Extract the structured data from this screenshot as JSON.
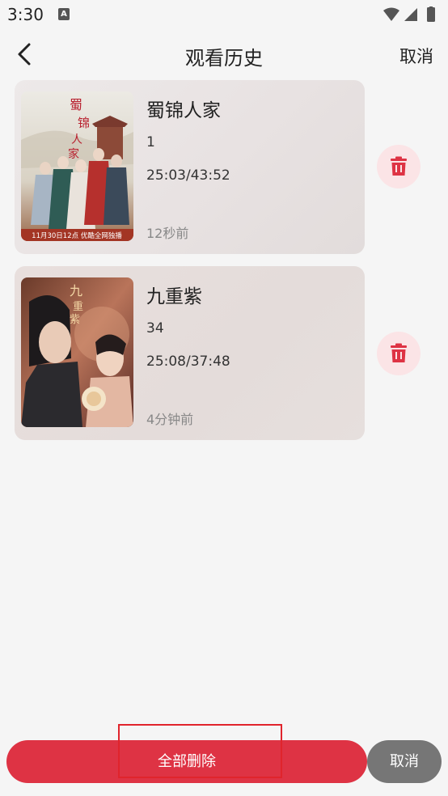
{
  "status_bar": {
    "time": "3:30",
    "notification_icon": "a-icon",
    "icons": [
      "wifi-icon",
      "signal-icon",
      "battery-icon"
    ]
  },
  "header": {
    "title": "观看历史",
    "back_icon": "chevron-left-icon",
    "cancel_label": "取消"
  },
  "history_items": [
    {
      "title": "蜀锦人家",
      "episode": "1",
      "progress": "25:03/43:52",
      "time_ago": "12秒前",
      "poster_caption": "11月30日12点 优酷全网独播",
      "poster_title": "蜀锦人家"
    },
    {
      "title": "九重紫",
      "episode": "34",
      "progress": "25:08/37:48",
      "time_ago": "4分钟前",
      "poster_title": "九重紫"
    }
  ],
  "actions": {
    "delete_all_label": "全部删除",
    "cancel_label": "取消",
    "delete_icon": "trash-icon"
  },
  "colors": {
    "accent": "#de3344",
    "delete_bg": "#fbe4e6",
    "cancel_bg": "#767676"
  }
}
